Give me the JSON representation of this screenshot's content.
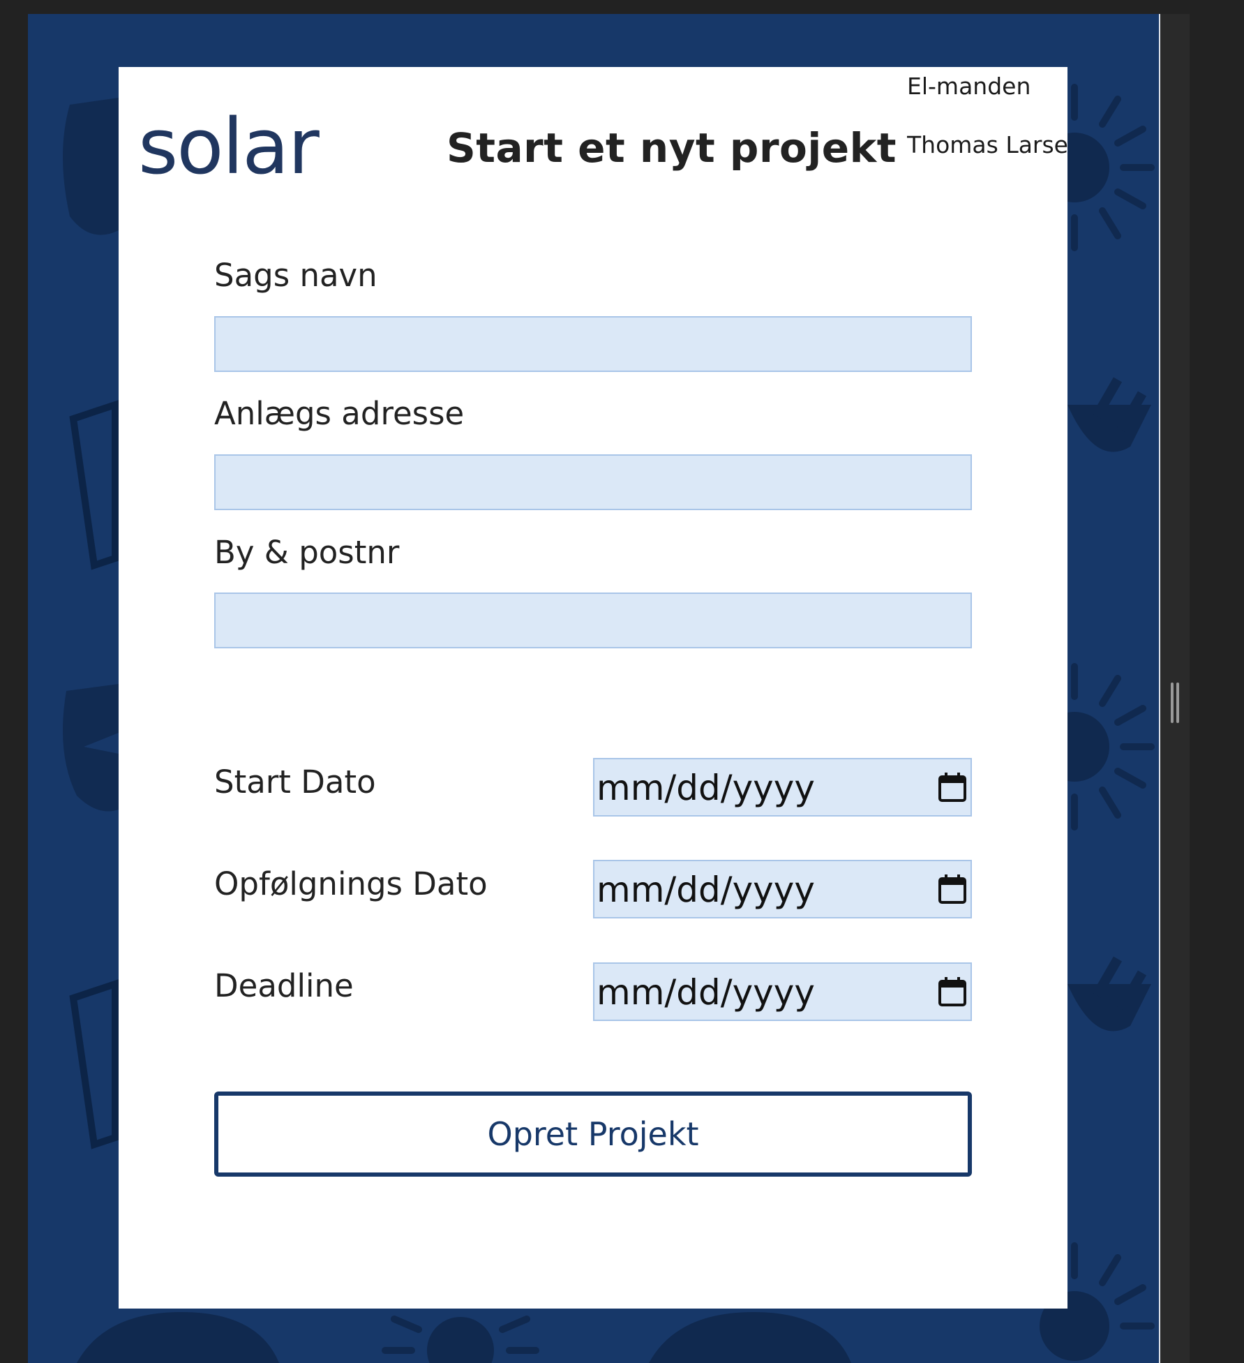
{
  "app": {
    "logo_text": "solar",
    "title": "Start et nyt projekt"
  },
  "user": {
    "company": "El-manden",
    "name": "Thomas Larsen"
  },
  "form": {
    "case_name": {
      "label": "Sags navn",
      "value": ""
    },
    "install_address": {
      "label": "Anlægs adresse",
      "value": ""
    },
    "city_zip": {
      "label": "By & postnr",
      "value": ""
    },
    "start_date": {
      "label": "Start Dato",
      "value": "mm/dd/yyyy"
    },
    "followup_date": {
      "label": "Opfølgnings Dato",
      "value": "mm/dd/yyyy"
    },
    "deadline": {
      "label": "Deadline",
      "value": "mm/dd/yyyy"
    },
    "submit_label": "Opret Projekt"
  },
  "icons": {
    "date_picker": "calendar-icon",
    "background": [
      "sun-icon",
      "plug-icon",
      "lightning-bolt-icon",
      "solar-panel-icon"
    ]
  },
  "colors": {
    "brand_navy": "#173869",
    "input_fill": "#dbe8f7",
    "input_border": "#a9c5e8",
    "page_background": "#222222"
  }
}
